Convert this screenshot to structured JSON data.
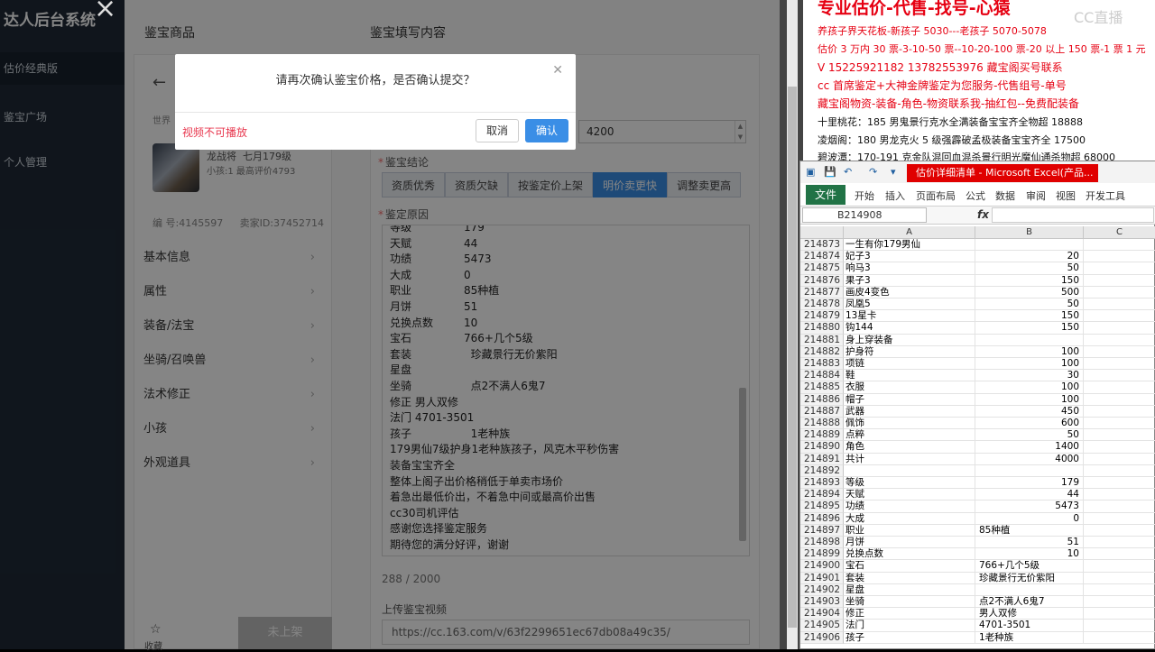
{
  "sidebar": {
    "brand": "达人后台系统",
    "items": [
      {
        "label": "估价经典版"
      },
      {
        "label": "鉴宝广场"
      },
      {
        "label": "个人管理"
      }
    ]
  },
  "panel": {
    "left_title": "鉴宝商品",
    "right_title": "鉴宝填写内容",
    "world_label": "世界",
    "account_name": "龙战将",
    "account_extra": "七月179级",
    "account_sub": "小孩:1 最高评价4793",
    "id_label": "编 号:4145597",
    "seller_label": "卖家ID:37452714",
    "menu": [
      {
        "label": "基本信息"
      },
      {
        "label": "属性"
      },
      {
        "label": "装备/法宝"
      },
      {
        "label": "坐骑/召唤兽"
      },
      {
        "label": "法术修正"
      },
      {
        "label": "小孩"
      },
      {
        "label": "外观道具"
      }
    ],
    "favorite_label": "收藏",
    "not_listed_label": "未上架",
    "price_value": "4200",
    "conclusion_label": "鉴宝结论",
    "conclusion_tabs": [
      {
        "label": "资质优秀"
      },
      {
        "label": "资质欠缺"
      },
      {
        "label": "按鉴定价上架"
      },
      {
        "label": "明价卖更快"
      },
      {
        "label": "调整卖更高"
      }
    ],
    "reason_label": "鉴定原因",
    "reason_lines": [
      {
        "k": "等级",
        "v": "179"
      },
      {
        "k": "天赋",
        "v": "44"
      },
      {
        "k": "功绩",
        "v": "5473"
      },
      {
        "k": "大成",
        "v": "0"
      },
      {
        "k": "职业",
        "v": "85种植"
      },
      {
        "k": "月饼",
        "v": "51"
      },
      {
        "k": "兑换点数",
        "v": "10"
      },
      {
        "k": "宝石",
        "v": "766+几个5级"
      },
      {
        "k": "套装",
        "v": "  珍藏景行无价紫阳"
      },
      {
        "k": "星盘",
        "v": ""
      },
      {
        "k": "坐骑",
        "v": "  点2不满人6鬼7"
      },
      {
        "k": "修正 男人双修",
        "v": ""
      },
      {
        "k": "法门 4701-3501",
        "v": ""
      },
      {
        "k": "孩子",
        "v": "  1老种族"
      },
      {
        "k": "179男仙7级护身1老种族孩子，风克木平秒伤害",
        "v": ""
      },
      {
        "k": "装备宝宝齐全",
        "v": ""
      },
      {
        "k": "整体上阁子出价格稍低于单卖市场价",
        "v": ""
      },
      {
        "k": "着急出最低价出，不着急中间或最高价出售",
        "v": ""
      },
      {
        "k": "cc30司机评估",
        "v": ""
      },
      {
        "k": "感谢您选择鉴定服务",
        "v": ""
      },
      {
        "k": "期待您的满分好评，谢谢",
        "v": ""
      }
    ],
    "counter": "288 / 2000",
    "upload_label": "上传鉴宝视频",
    "video_url": "https://cc.163.com/v/63f2299651ec67db08a49c35/"
  },
  "dialog": {
    "message": "请再次确认鉴宝价格，是否确认提交？",
    "video_error": "视频不可播放",
    "cancel_label": "取消",
    "confirm_label": "确认"
  },
  "notes": {
    "title": "专业估价-代售-找号-心猿",
    "watermark": "CC直播",
    "lines": [
      {
        "text": "养孩子界天花板-新孩子 5030---老孩子 5070-5078"
      },
      {
        "text": "估价 3 万内 30 票-3-10-50 票--10-20-100 票-20 以上 150 票-1 票 1 元"
      },
      {
        "text": "V 15225921182    13782553976    藏宝阁买号联系"
      },
      {
        "text": "cc 首席鉴定+大神金牌鉴定为您服务-代售组号-单号"
      },
      {
        "text": "藏宝阁物资-装备-角色-物资联系我-抽红包--免费配装备"
      },
      {
        "text": "十里桃花：185 男鬼景行克水全满装备宝宝齐全物超 18888"
      },
      {
        "text": "凌烟阁：180 男龙克火 5 级强霹破孟极装备宝宝齐全 17500"
      },
      {
        "text": "碧波潭：170-191 克金队混回血混杀景行明光魔仙通杀物超 68000"
      }
    ]
  },
  "excel": {
    "title": "估价详细清单 - Microsoft Excel(产品...",
    "tabs": [
      "文件",
      "开始",
      "插入",
      "页面布局",
      "公式",
      "数据",
      "审阅",
      "视图",
      "开发工具"
    ],
    "name_box": "B214908",
    "fx": "fx",
    "col_headers": [
      "A",
      "B",
      "C"
    ],
    "rows": [
      {
        "n": "214873",
        "a": "一生有你179男仙",
        "b": ""
      },
      {
        "n": "214874",
        "a": "妃子3",
        "b": "20"
      },
      {
        "n": "214875",
        "a": "响马3",
        "b": "50"
      },
      {
        "n": "214876",
        "a": "果子3",
        "b": "150"
      },
      {
        "n": "214877",
        "a": "画皮4变色",
        "b": "500"
      },
      {
        "n": "214878",
        "a": "凤凰5",
        "b": "50"
      },
      {
        "n": "214879",
        "a": "13星卡",
        "b": "150"
      },
      {
        "n": "214880",
        "a": "钩144",
        "b": "150"
      },
      {
        "n": "214881",
        "a": "身上穿装备",
        "b": ""
      },
      {
        "n": "214882",
        "a": "护身符",
        "b": "100"
      },
      {
        "n": "214883",
        "a": "项链",
        "b": "100"
      },
      {
        "n": "214884",
        "a": "鞋",
        "b": "30"
      },
      {
        "n": "214885",
        "a": "衣服",
        "b": "100"
      },
      {
        "n": "214886",
        "a": "帽子",
        "b": "100"
      },
      {
        "n": "214887",
        "a": "武器",
        "b": "450"
      },
      {
        "n": "214888",
        "a": "佩饰",
        "b": "600"
      },
      {
        "n": "214889",
        "a": "点粹",
        "b": "50"
      },
      {
        "n": "214890",
        "a": "角色",
        "b": "1400"
      },
      {
        "n": "214891",
        "a": "共计",
        "b": "4000"
      },
      {
        "n": "214892",
        "a": "",
        "b": ""
      },
      {
        "n": "214893",
        "a": "等级",
        "b": "179"
      },
      {
        "n": "214894",
        "a": "天赋",
        "b": "44"
      },
      {
        "n": "214895",
        "a": "功绩",
        "b": "5473"
      },
      {
        "n": "214896",
        "a": "大成",
        "b": "0"
      },
      {
        "n": "214897",
        "a": "职业",
        "b": "85种植",
        "t": true
      },
      {
        "n": "214898",
        "a": "月饼",
        "b": "51"
      },
      {
        "n": "214899",
        "a": "兑换点数",
        "b": "10"
      },
      {
        "n": "214900",
        "a": "宝石",
        "b": "766+几个5级",
        "t": true
      },
      {
        "n": "214901",
        "a": "套装",
        "b": "珍藏景行无价紫阳",
        "t": true
      },
      {
        "n": "214902",
        "a": "星盘",
        "b": ""
      },
      {
        "n": "214903",
        "a": "坐骑",
        "b": "点2不满人6鬼7",
        "t": true
      },
      {
        "n": "214904",
        "a": "修正",
        "b": "男人双修",
        "t": true
      },
      {
        "n": "214905",
        "a": "法门",
        "b": "4701-3501",
        "t": true
      },
      {
        "n": "214906",
        "a": "孩子",
        "b": "1老种族",
        "t": true
      }
    ]
  }
}
